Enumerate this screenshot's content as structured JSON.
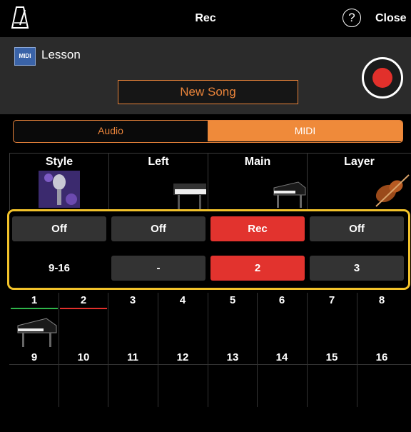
{
  "header": {
    "title": "Rec",
    "help_icon": "?",
    "close_label": "Close"
  },
  "lesson": {
    "badge": "MIDI",
    "label": "Lesson",
    "new_song_label": "New Song"
  },
  "tabs": {
    "audio": "Audio",
    "midi": "MIDI",
    "selected": "MIDI"
  },
  "parts": [
    {
      "name": "Style",
      "icon": "microphone-icon"
    },
    {
      "name": "Left",
      "icon": "keyboard-icon"
    },
    {
      "name": "Main",
      "icon": "grand-piano-icon"
    },
    {
      "name": "Layer",
      "icon": "violin-icon"
    }
  ],
  "status_row": [
    "Off",
    "Off",
    "Rec",
    "Off"
  ],
  "channel_row": {
    "label": "9-16",
    "values": [
      "-",
      "2",
      "3"
    ]
  },
  "channels_top": [
    "1",
    "2",
    "3",
    "4",
    "5",
    "6",
    "7",
    "8"
  ],
  "channels_bottom": [
    "9",
    "10",
    "11",
    "12",
    "13",
    "14",
    "15",
    "16"
  ],
  "colors": {
    "accent": "#e8833a",
    "record_red": "#e2302b",
    "highlight_frame": "#f2c22a",
    "channel1_underline": "#2fb54a",
    "channel2_underline": "#e2302b"
  }
}
